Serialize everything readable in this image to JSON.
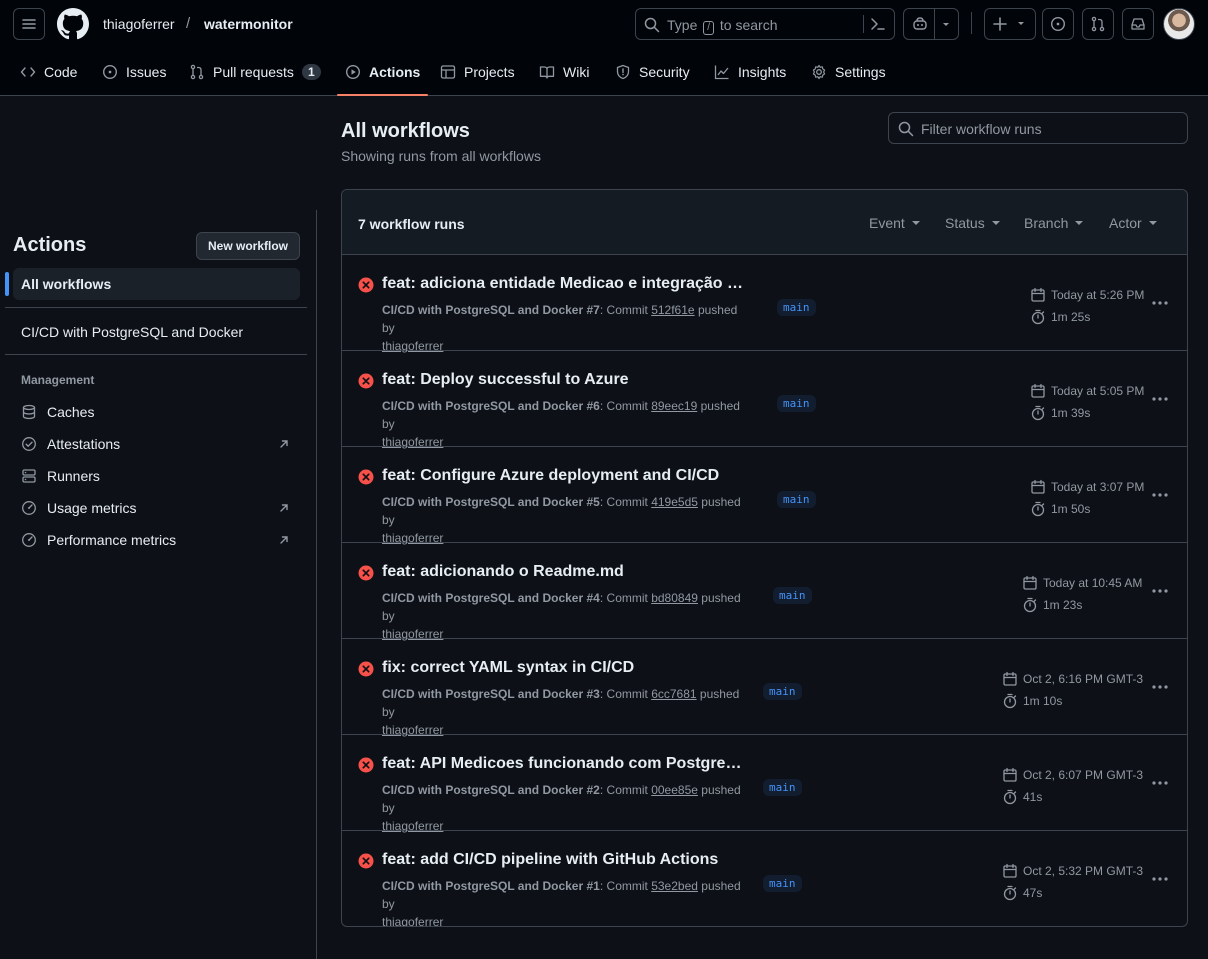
{
  "header": {
    "owner": "thiagoferrer",
    "separator": "/",
    "repo": "watermonitor",
    "search_prefix": "Type",
    "search_key": "/",
    "search_suffix": "to search"
  },
  "repo_nav": {
    "tabs": [
      {
        "label": "Code",
        "icon": "code-icon"
      },
      {
        "label": "Issues",
        "icon": "issue-icon"
      },
      {
        "label": "Pull requests",
        "icon": "pull-request-icon",
        "count": "1"
      },
      {
        "label": "Actions",
        "icon": "play-icon",
        "active": true
      },
      {
        "label": "Projects",
        "icon": "table-icon"
      },
      {
        "label": "Wiki",
        "icon": "book-icon"
      },
      {
        "label": "Security",
        "icon": "shield-icon"
      },
      {
        "label": "Insights",
        "icon": "graph-icon"
      },
      {
        "label": "Settings",
        "icon": "gear-icon"
      }
    ]
  },
  "sidebar": {
    "title": "Actions",
    "new_workflow_label": "New workflow",
    "all_workflows_label": "All workflows",
    "workflows": [
      "CI/CD with PostgreSQL and Docker"
    ],
    "management_heading": "Management",
    "management_items": [
      {
        "label": "Caches",
        "icon": "database-icon"
      },
      {
        "label": "Attestations",
        "icon": "verified-icon",
        "external": true
      },
      {
        "label": "Runners",
        "icon": "server-icon"
      },
      {
        "label": "Usage metrics",
        "icon": "meter-icon",
        "external": true
      },
      {
        "label": "Performance metrics",
        "icon": "meter-icon",
        "external": true
      }
    ]
  },
  "main": {
    "title": "All workflows",
    "subtitle": "Showing runs from all workflows",
    "filter_placeholder": "Filter workflow runs",
    "runs_count": "7 workflow runs",
    "filters": [
      "Event",
      "Status",
      "Branch",
      "Actor"
    ],
    "runs": [
      {
        "title": "feat: adiciona entidade Medicao e integração co...",
        "workflow": "CI/CD with PostgreSQL and Docker",
        "number": "#7",
        "commit": "512f61e",
        "pushed_by": "pushed by",
        "user": "thiagoferrer",
        "branch": "main",
        "date": "Today at 5:26 PM",
        "duration": "1m 25s",
        "status": "failure"
      },
      {
        "title": "feat: Deploy successful to Azure",
        "workflow": "CI/CD with PostgreSQL and Docker",
        "number": "#6",
        "commit": "89eec19",
        "pushed_by": "pushed by",
        "user": "thiagoferrer",
        "branch": "main",
        "date": "Today at 5:05 PM",
        "duration": "1m 39s",
        "status": "failure"
      },
      {
        "title": "feat: Configure Azure deployment and CI/CD",
        "workflow": "CI/CD with PostgreSQL and Docker",
        "number": "#5",
        "commit": "419e5d5",
        "pushed_by": "pushed by",
        "user": "thiagoferrer",
        "branch": "main",
        "date": "Today at 3:07 PM",
        "duration": "1m 50s",
        "status": "failure"
      },
      {
        "title": "feat: adicionando o Readme.md",
        "workflow": "CI/CD with PostgreSQL and Docker",
        "number": "#4",
        "commit": "bd80849",
        "pushed_by": "pushed by",
        "user": "thiagoferrer",
        "branch": "main",
        "date": "Today at 10:45 AM",
        "duration": "1m 23s",
        "status": "failure"
      },
      {
        "title": "fix: correct YAML syntax in CI/CD",
        "workflow": "CI/CD with PostgreSQL and Docker",
        "number": "#3",
        "commit": "6cc7681",
        "pushed_by": "pushed by",
        "user": "thiagoferrer",
        "branch": "main",
        "date": "Oct 2, 6:16 PM GMT-3",
        "duration": "1m 10s",
        "status": "failure"
      },
      {
        "title": "feat: API Medicoes funcionando com PostgreSQL",
        "workflow": "CI/CD with PostgreSQL and Docker",
        "number": "#2",
        "commit": "00ee85e",
        "pushed_by": "pushed by",
        "user": "thiagoferrer",
        "branch": "main",
        "date": "Oct 2, 6:07 PM GMT-3",
        "duration": "41s",
        "status": "failure"
      },
      {
        "title": "feat: add CI/CD pipeline with GitHub Actions",
        "workflow": "CI/CD with PostgreSQL and Docker",
        "number": "#1",
        "commit": "53e2bed",
        "pushed_by": "pushed by",
        "user": "thiagoferrer",
        "branch": "main",
        "date": "Oct 2, 5:32 PM GMT-3",
        "duration": "47s",
        "status": "failure"
      }
    ]
  },
  "colors": {
    "background": "#0d1117",
    "header_bg": "#010409",
    "border": "#3d444d",
    "accent_blue": "#4493f8",
    "failure_red": "#f85149",
    "active_tab_underline": "#f78166"
  }
}
